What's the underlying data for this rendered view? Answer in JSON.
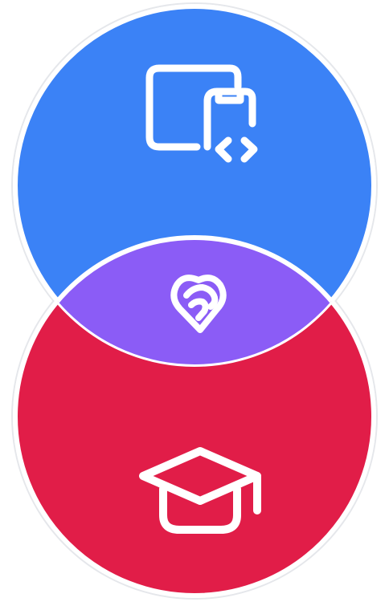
{
  "diagram": {
    "type": "venn",
    "sets": [
      {
        "icon": "code-snippet-icon",
        "color": "#3b82f6"
      },
      {
        "icon": "graduation-cap-icon",
        "color": "#e11d48"
      }
    ],
    "intersection": {
      "icon": "heart-handshake-icon",
      "color": "#8b5cf6"
    },
    "outline_color": "#ffffff",
    "icon_color": "#ffffff"
  }
}
